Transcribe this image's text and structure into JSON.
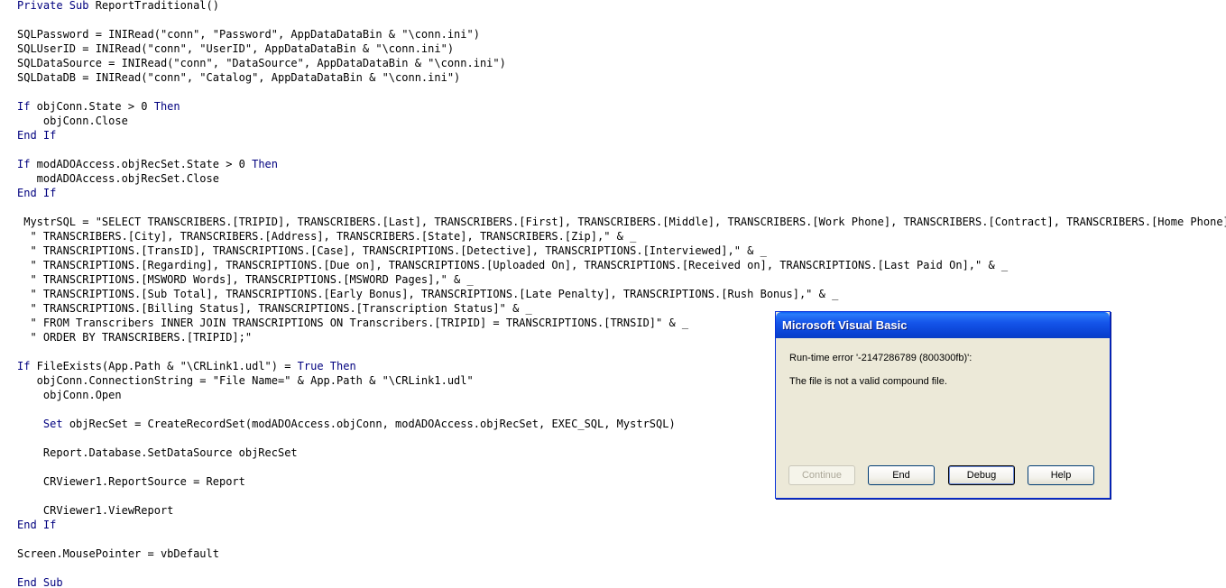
{
  "editor": {
    "lines": [
      [
        {
          "t": "Private Sub",
          "k": true
        },
        {
          "t": " ReportTraditional()"
        }
      ],
      [
        {
          "t": ""
        }
      ],
      [
        {
          "t": "SQLPassword = INIRead(\"conn\", \"Password\", AppDataDataBin & \"\\conn.ini\")"
        }
      ],
      [
        {
          "t": "SQLUserID = INIRead(\"conn\", \"UserID\", AppDataDataBin & \"\\conn.ini\")"
        }
      ],
      [
        {
          "t": "SQLDataSource = INIRead(\"conn\", \"DataSource\", AppDataDataBin & \"\\conn.ini\")"
        }
      ],
      [
        {
          "t": "SQLDataDB = INIRead(\"conn\", \"Catalog\", AppDataDataBin & \"\\conn.ini\")"
        }
      ],
      [
        {
          "t": ""
        }
      ],
      [
        {
          "t": "If",
          "k": true
        },
        {
          "t": " objConn.State > 0 "
        },
        {
          "t": "Then",
          "k": true
        }
      ],
      [
        {
          "t": "    objConn.Close"
        }
      ],
      [
        {
          "t": "End If",
          "k": true
        }
      ],
      [
        {
          "t": ""
        }
      ],
      [
        {
          "t": "If",
          "k": true
        },
        {
          "t": " modADOAccess.objRecSet.State > 0 "
        },
        {
          "t": "Then",
          "k": true
        }
      ],
      [
        {
          "t": "   modADOAccess.objRecSet.Close"
        }
      ],
      [
        {
          "t": "End If",
          "k": true
        }
      ],
      [
        {
          "t": ""
        }
      ],
      [
        {
          "t": " MystrSQL = \"SELECT TRANSCRIBERS.[TRIPID], TRANSCRIBERS.[Last], TRANSCRIBERS.[First], TRANSCRIBERS.[Middle], TRANSCRIBERS.[Work Phone], TRANSCRIBERS.[Contract], TRANSCRIBERS.[Home Phone],\" & _"
        }
      ],
      [
        {
          "t": "  \" TRANSCRIBERS.[City], TRANSCRIBERS.[Address], TRANSCRIBERS.[State], TRANSCRIBERS.[Zip],\" & _"
        }
      ],
      [
        {
          "t": "  \" TRANSCRIPTIONS.[TransID], TRANSCRIPTIONS.[Case], TRANSCRIPTIONS.[Detective], TRANSCRIPTIONS.[Interviewed],\" & _"
        }
      ],
      [
        {
          "t": "  \" TRANSCRIPTIONS.[Regarding], TRANSCRIPTIONS.[Due on], TRANSCRIPTIONS.[Uploaded On], TRANSCRIPTIONS.[Received on], TRANSCRIPTIONS.[Last Paid On],\" & _"
        }
      ],
      [
        {
          "t": "  \" TRANSCRIPTIONS.[MSWORD Words], TRANSCRIPTIONS.[MSWORD Pages],\" & _"
        }
      ],
      [
        {
          "t": "  \" TRANSCRIPTIONS.[Sub Total], TRANSCRIPTIONS.[Early Bonus], TRANSCRIPTIONS.[Late Penalty], TRANSCRIPTIONS.[Rush Bonus],\" & _"
        }
      ],
      [
        {
          "t": "  \" TRANSCRIPTIONS.[Billing Status], TRANSCRIPTIONS.[Transcription Status]\" & _"
        }
      ],
      [
        {
          "t": "  \" FROM Transcribers INNER JOIN TRANSCRIPTIONS ON Transcribers.[TRIPID] = TRANSCRIPTIONS.[TRNSID]\" & _"
        }
      ],
      [
        {
          "t": "  \" ORDER BY TRANSCRIBERS.[TRIPID];\""
        }
      ],
      [
        {
          "t": ""
        }
      ],
      [
        {
          "t": "If",
          "k": true
        },
        {
          "t": " FileExists(App.Path & \"\\CRLink1.udl\") = "
        },
        {
          "t": "True Then",
          "k": true
        }
      ],
      [
        {
          "t": "   objConn.ConnectionString = \"File Name=\" & App.Path & \"\\CRLink1.udl\""
        }
      ],
      [
        {
          "t": "    objConn.Open"
        }
      ],
      [
        {
          "t": ""
        }
      ],
      [
        {
          "t": "    "
        },
        {
          "t": "Set",
          "k": true
        },
        {
          "t": " objRecSet = CreateRecordSet(modADOAccess.objConn, modADOAccess.objRecSet, EXEC_SQL, MystrSQL)"
        }
      ],
      [
        {
          "t": ""
        }
      ],
      [
        {
          "t": "    Report.Database.SetDataSource objRecSet"
        }
      ],
      [
        {
          "t": ""
        }
      ],
      [
        {
          "t": "    CRViewer1.ReportSource = Report"
        }
      ],
      [
        {
          "t": ""
        }
      ],
      [
        {
          "t": "    CRViewer1.ViewReport"
        }
      ],
      [
        {
          "t": "End If",
          "k": true
        }
      ],
      [
        {
          "t": ""
        }
      ],
      [
        {
          "t": "Screen.MousePointer = vbDefault"
        }
      ],
      [
        {
          "t": ""
        }
      ],
      [
        {
          "t": "End Sub",
          "k": true
        }
      ]
    ],
    "keyword_color": "#00007f",
    "text_color": "#000000"
  },
  "dialog": {
    "title": "Microsoft Visual Basic",
    "error_code": "Run-time error '-2147286789 (800300fb)':",
    "message": "The file is not a valid compound file.",
    "buttons": {
      "continue": "Continue",
      "end": "End",
      "debug": "Debug",
      "help": "Help"
    },
    "titlebar_color": "#0a46d6",
    "face_color": "#ece9d8"
  }
}
